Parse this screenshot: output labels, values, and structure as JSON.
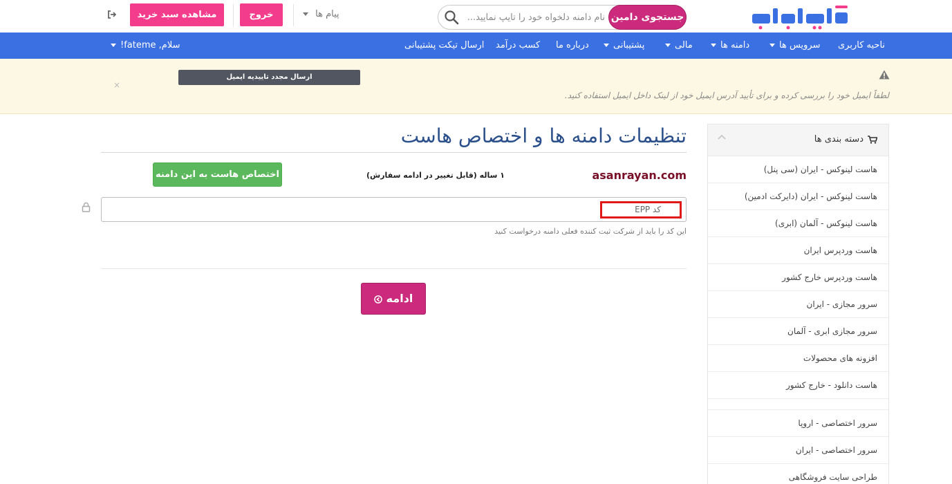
{
  "header": {
    "search_button": "جستجوی دامین",
    "search_placeholder": "نام دامنه دلخواه خود را تایپ نمایید...",
    "messages": "پیام ها",
    "logout": "خروج",
    "view_cart": "مشاهده سبد خرید"
  },
  "nav": {
    "items": [
      {
        "label": "ناحیه کاربری"
      },
      {
        "label": "سرویس ها"
      },
      {
        "label": "دامنه ها"
      },
      {
        "label": "مالی"
      },
      {
        "label": "پشتیبانی"
      },
      {
        "label": "درباره ما"
      },
      {
        "label": "کسب درآمد"
      },
      {
        "label": "ارسال تیکت پشتیبانی"
      }
    ],
    "greeting": "سلام, fateme!"
  },
  "alert": {
    "message": "لطفاً ایمیل خود را بررسی کرده و برای تأیید آدرس ایمیل خود از لینک داخل ایمیل استفاده کنید.",
    "resend_button": "ارسال مجدد تاییدیه ایمیل",
    "close": "×"
  },
  "sidebar": {
    "title": "دسته بندی ها",
    "items": [
      "هاست لینوکس - ایران (سی پنل)",
      "هاست لینوکس - ایران (دایرکت ادمین)",
      "هاست لینوکس - آلمان (ابری)",
      "هاست وردپرس ایران",
      "هاست وردپرس خارج کشور",
      "سرور مجازی - ایران",
      "سرور مجازی ابری - آلمان",
      "افزونه های محصولات",
      "هاست دانلود - خارج کشور",
      "سرور اختصاصی - اروپا",
      "سرور اختصاصی - ایران",
      "طراحی سایت فروشگاهی"
    ]
  },
  "main": {
    "title": "تنظیمات دامنه ها و اختصاص هاست",
    "domain": "asanrayan.com",
    "period": "۱ ساله (قابل تغییر در ادامه سفارش)",
    "assign_host_button": "اختصاص هاست به این دامنه",
    "epp_placeholder": "کد EPP",
    "epp_help": "این کد را باید از شرکت ثبت کننده فعلی دامنه درخواست کنید",
    "continue_button": "ادامه"
  },
  "colors": {
    "brand_blue": "#3b70e3",
    "brand_pink": "#cc2a7c",
    "button_pink": "#f43c8d",
    "success_green": "#5cb85c"
  }
}
